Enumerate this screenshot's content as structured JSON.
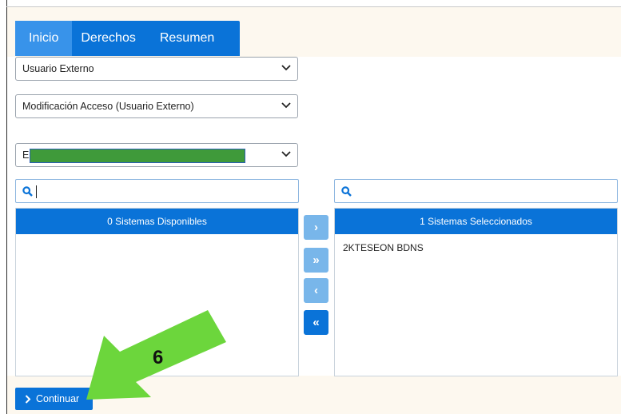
{
  "tabs": [
    {
      "label": "Inicio",
      "active": true
    },
    {
      "label": "Derechos",
      "active": false
    },
    {
      "label": "Resumen",
      "active": false
    }
  ],
  "selects": {
    "user_type": "Usuario Externo",
    "request_type": "Modificación Acceso (Usuario Externo)",
    "entity": "EX"
  },
  "left_search": {
    "placeholder": "",
    "value": ""
  },
  "right_search": {
    "placeholder": "",
    "value": ""
  },
  "available_panel": {
    "title": "0 Sistemas Disponibles",
    "items": []
  },
  "selected_panel": {
    "title": "1 Sistemas Seleccionados",
    "items": [
      "2KTESEON BDNS"
    ]
  },
  "move_buttons": [
    {
      "label": "›",
      "name": "move-right-button",
      "state": "disabled"
    },
    {
      "label": "»",
      "name": "move-all-right-button",
      "state": "disabled"
    },
    {
      "label": "‹",
      "name": "move-left-button",
      "state": "disabled"
    },
    {
      "label": "«",
      "name": "move-all-left-button",
      "state": "enabled"
    }
  ],
  "continue_label": "Continuar",
  "annotation": {
    "step_number": "6",
    "color": "#6cd63c"
  },
  "colors": {
    "primary": "#0a73d8",
    "tab_active": "#3893ea",
    "disabled_button": "#78b6ea",
    "frame_bg": "#fdf8ef"
  }
}
